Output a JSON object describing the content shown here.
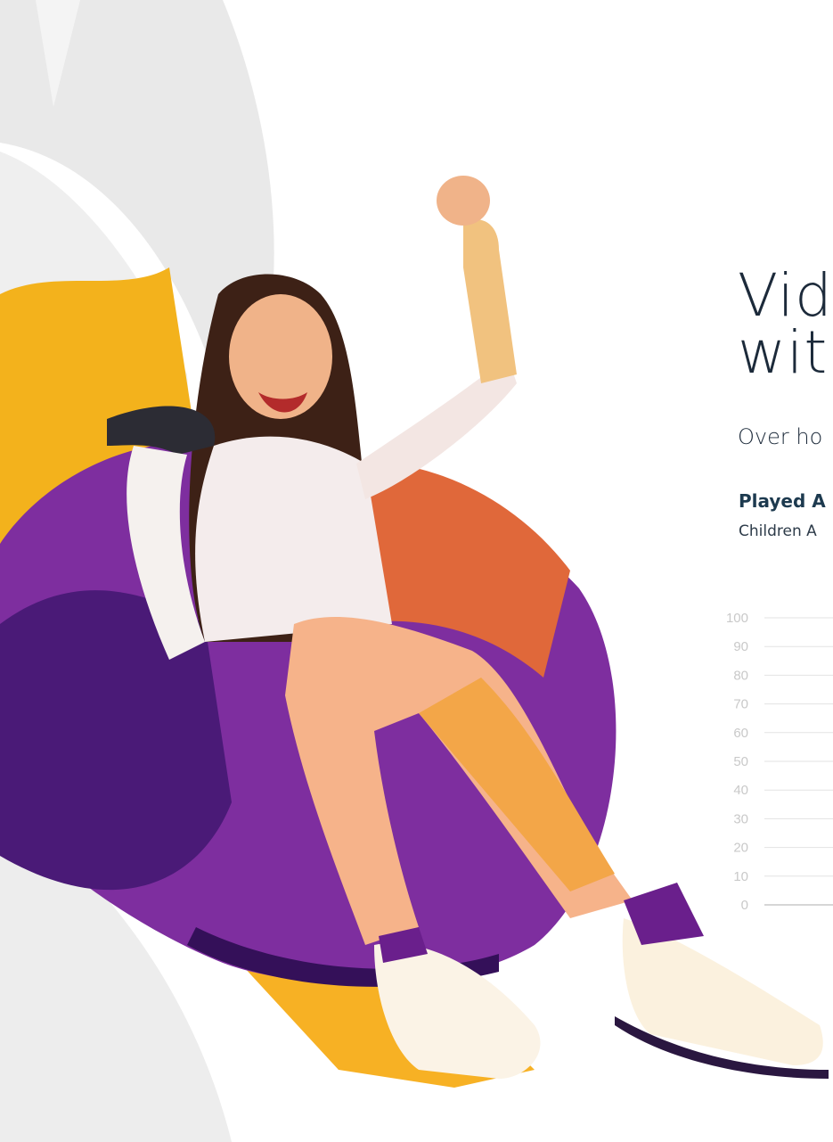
{
  "header": {
    "title_line1": "Vide",
    "title_line2": "with",
    "subtitle": "Over ho"
  },
  "chart_section": {
    "title": "Played A",
    "subtitle": "Children A"
  },
  "colors": {
    "purple": "#7a2a9c",
    "deep_purple": "#4b1a78",
    "orange": "#f1a91a",
    "text": "#1c2a3a",
    "axis_label": "#c9c9c9",
    "gridline": "#e3e3e3"
  },
  "chart_data": {
    "type": "bar",
    "title": "Played A",
    "subtitle": "Children A",
    "ylim": [
      0,
      100
    ],
    "yticks": [
      0,
      10,
      20,
      30,
      40,
      50,
      60,
      70,
      80,
      90,
      100
    ],
    "grid": true,
    "categories": [],
    "values": []
  }
}
